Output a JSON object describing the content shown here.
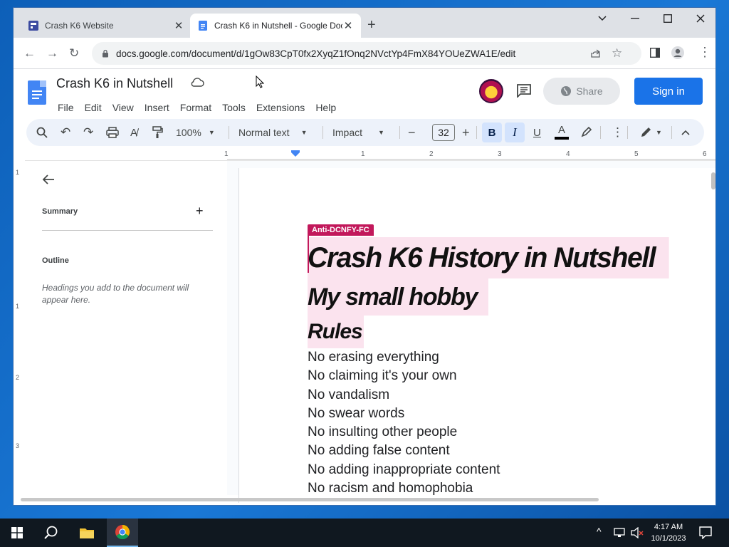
{
  "browser": {
    "tabs": [
      {
        "title": "Crash K6 Website"
      },
      {
        "title": "Crash K6 in Nutshell - Google Docs"
      }
    ],
    "url": "docs.google.com/document/d/1gOw83CpT0fx2XyqZ1fOnq2NVctYp4FmX84YOUeZWA1E/edit"
  },
  "docs": {
    "title": "Crash K6 in Nutshell",
    "menus": [
      "File",
      "Edit",
      "View",
      "Insert",
      "Format",
      "Tools",
      "Extensions",
      "Help"
    ],
    "share_label": "Share",
    "signin_label": "Sign in",
    "toolbar": {
      "zoom": "100%",
      "style": "Normal text",
      "font": "Impact",
      "font_size": "32"
    },
    "ruler_ticks": [
      "1",
      "1",
      "2",
      "3",
      "4",
      "5",
      "6"
    ],
    "vruler_ticks": [
      "1",
      "1",
      "2",
      "3"
    ],
    "sidepanel": {
      "summary_label": "Summary",
      "outline_label": "Outline",
      "outline_hint": "Headings you add to the document will appear here."
    },
    "page": {
      "collaborator_chip": "Anti-DCNFY-FC",
      "heading1": "Crash K6 History in Nutshell",
      "heading2": "My small hobby",
      "heading3": "Rules",
      "rules": [
        "No erasing everything",
        "No claiming it's your own",
        "No vandalism",
        "No swear words",
        "No insulting other people",
        "No adding false content",
        "No adding inappropriate content",
        "No racism and homophobia"
      ]
    }
  },
  "taskbar": {
    "time": "4:17 AM",
    "date": "10/1/2023"
  },
  "colors": {
    "accent": "#1a73e8",
    "highlight": "#fbe3ee",
    "chip": "#c2185b"
  }
}
